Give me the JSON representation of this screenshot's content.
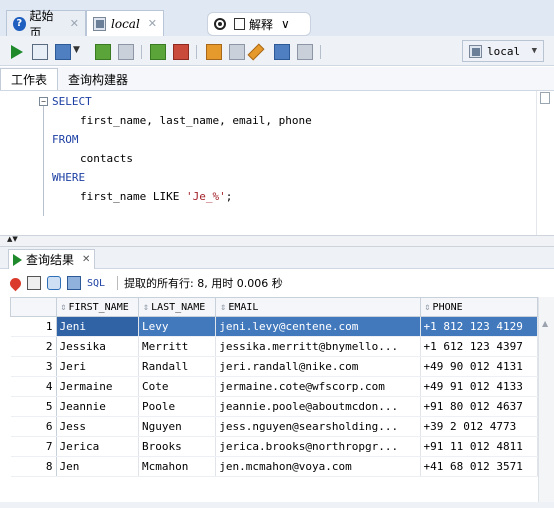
{
  "tabs": [
    {
      "label": "起始页",
      "active": false
    },
    {
      "label": "local",
      "active": true
    }
  ],
  "explain": {
    "label": "解释"
  },
  "toolbar": {
    "connection": "local"
  },
  "subtabs": [
    {
      "label": "工作表",
      "active": true
    },
    {
      "label": "查询构建器",
      "active": false
    }
  ],
  "editor": {
    "lines": [
      {
        "kw": "SELECT",
        "text": ""
      },
      {
        "kw": "",
        "text": "first_name, last_name, email, phone"
      },
      {
        "kw": "FROM",
        "text": ""
      },
      {
        "kw": "",
        "text": "contacts"
      },
      {
        "kw": "WHERE",
        "text": ""
      },
      {
        "kw": "",
        "text": "first_name LIKE 'Je_%';"
      }
    ],
    "line6": {
      "pre": "first_name LIKE ",
      "str": "'Je_%'",
      "post": ";"
    }
  },
  "results": {
    "tab_label": "查询结果",
    "sql_label": "SQL",
    "status": "提取的所有行: 8, 用时 0.006 秒",
    "columns": [
      "FIRST_NAME",
      "LAST_NAME",
      "EMAIL",
      "PHONE"
    ],
    "rows": [
      [
        "1",
        "Jeni",
        "Levy",
        "jeni.levy@centene.com",
        "+1 812 123 4129"
      ],
      [
        "2",
        "Jessika",
        "Merritt",
        "jessika.merritt@bnymello...",
        "+1 612 123 4397"
      ],
      [
        "3",
        "Jeri",
        "Randall",
        "jeri.randall@nike.com",
        "+49 90 012 4131"
      ],
      [
        "4",
        "Jermaine",
        "Cote",
        "jermaine.cote@wfscorp.com",
        "+49 91 012 4133"
      ],
      [
        "5",
        "Jeannie",
        "Poole",
        "jeannie.poole@aboutmcdon...",
        "+91 80 012 4637"
      ],
      [
        "6",
        "Jess",
        "Nguyen",
        "jess.nguyen@searsholding...",
        "+39 2 012 4773"
      ],
      [
        "7",
        "Jerica",
        "Brooks",
        "jerica.brooks@northropgr...",
        "+91 11 012 4811"
      ],
      [
        "8",
        "Jen",
        "Mcmahon",
        "jen.mcmahon@voya.com",
        "+41 68 012 3571"
      ]
    ],
    "selected_row": 0
  },
  "colors": {
    "accent": "#4279bd",
    "keyword": "#1c3fa3",
    "string": "#a3222a"
  }
}
